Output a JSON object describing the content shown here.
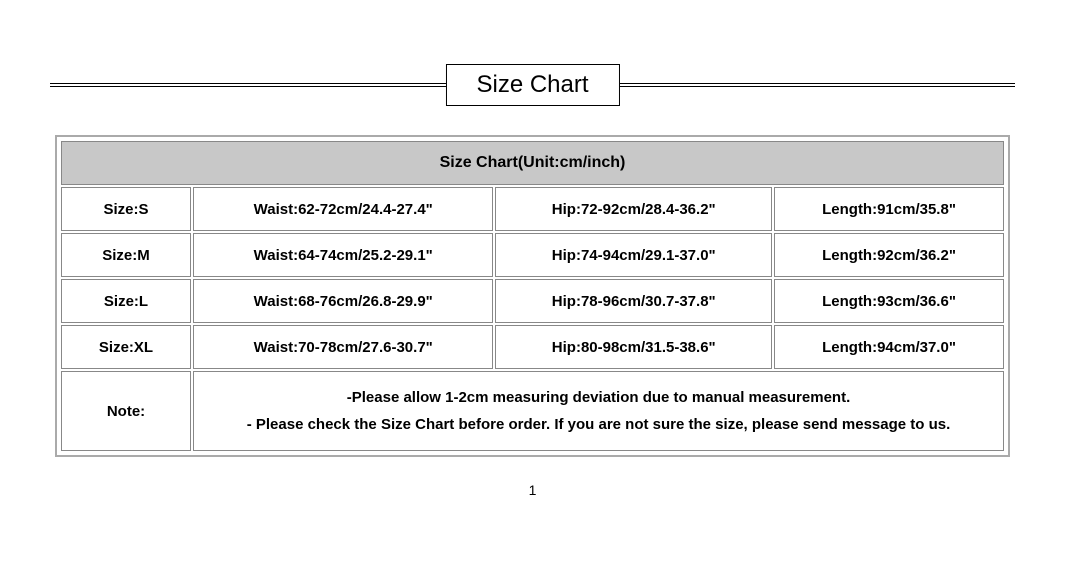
{
  "chart_data": {
    "type": "table",
    "title": "Size Chart(Unit:cm/inch)",
    "columns": [
      "Size",
      "Waist",
      "Hip",
      "Length"
    ],
    "rows": [
      {
        "size": "S",
        "waist_cm": "62-72",
        "waist_in": "24.4-27.4",
        "hip_cm": "72-92",
        "hip_in": "28.4-36.2",
        "length_cm": "91",
        "length_in": "35.8"
      },
      {
        "size": "M",
        "waist_cm": "64-74",
        "waist_in": "25.2-29.1",
        "hip_cm": "74-94",
        "hip_in": "29.1-37.0",
        "length_cm": "92",
        "length_in": "36.2"
      },
      {
        "size": "L",
        "waist_cm": "68-76",
        "waist_in": "26.8-29.9",
        "hip_cm": "78-96",
        "hip_in": "30.7-37.8",
        "length_cm": "93",
        "length_in": "36.6"
      },
      {
        "size": "XL",
        "waist_cm": "70-78",
        "waist_in": "27.6-30.7",
        "hip_cm": "80-98",
        "hip_in": "31.5-38.6",
        "length_cm": "94",
        "length_in": "37.0"
      }
    ]
  },
  "header": "Size Chart",
  "table_title": "Size Chart(Unit:cm/inch)",
  "sizes": {
    "s": {
      "label": "Size:S",
      "waist": "Waist:62-72cm/24.4-27.4\"",
      "hip": "Hip:72-92cm/28.4-36.2\"",
      "length": "Length:91cm/35.8\""
    },
    "m": {
      "label": "Size:M",
      "waist": "Waist:64-74cm/25.2-29.1\"",
      "hip": "Hip:74-94cm/29.1-37.0\"",
      "length": "Length:92cm/36.2\""
    },
    "l": {
      "label": "Size:L",
      "waist": "Waist:68-76cm/26.8-29.9\"",
      "hip": "Hip:78-96cm/30.7-37.8\"",
      "length": "Length:93cm/36.6\""
    },
    "xl": {
      "label": "Size:XL",
      "waist": "Waist:70-78cm/27.6-30.7\"",
      "hip": "Hip:80-98cm/31.5-38.6\"",
      "length": "Length:94cm/37.0\""
    }
  },
  "note": {
    "label": "Note:",
    "line1": "-Please allow 1-2cm measuring deviation due to manual measurement.",
    "line2": "- Please check the Size Chart before order. If you are not sure the size, please send message to us."
  },
  "page_number": "1"
}
